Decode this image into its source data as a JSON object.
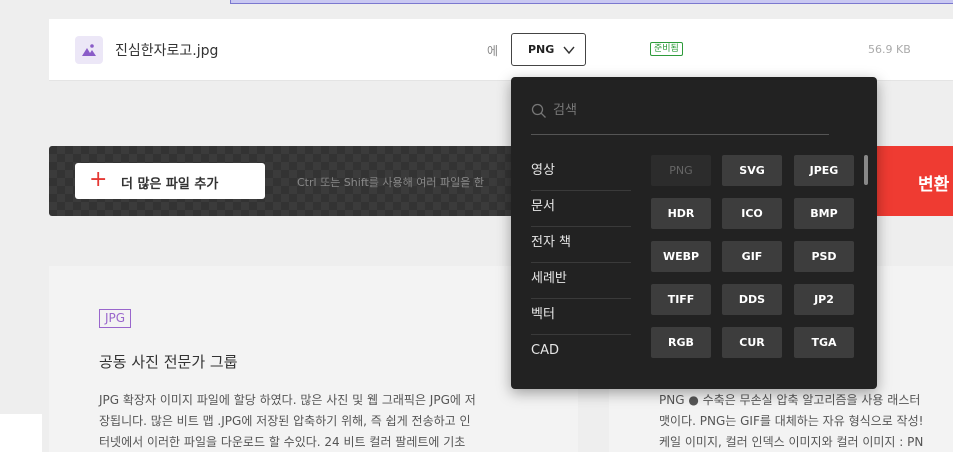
{
  "file": {
    "name": "진심한자로고.jpg",
    "to_label": "에",
    "target_format": "PNG",
    "status": "준비됨",
    "size": "56.9 KB"
  },
  "actions": {
    "add_label": "더 많은 파일 추가",
    "hint": "Ctrl 또는 Shift를 사용해 여러 파일을 한",
    "convert_label": "변환"
  },
  "dropdown": {
    "search_placeholder": "검색",
    "categories": [
      "영상",
      "문서",
      "전자 책",
      "세례반",
      "벡터",
      "CAD"
    ],
    "formats": [
      "PNG",
      "SVG",
      "JPEG",
      "HDR",
      "ICO",
      "BMP",
      "WEBP",
      "GIF",
      "PSD",
      "TIFF",
      "DDS",
      "JP2",
      "RGB",
      "CUR",
      "TGA"
    ],
    "selected_format": "PNG"
  },
  "cards": {
    "left": {
      "tag": "JPG",
      "title": "공동 사진 전문가 그룹",
      "lines": [
        "JPG 확장자 이미지 파일에 할당 하였다. 많은 사진 및 웹 그래픽은 JPG에 저",
        "장됩니다. 많은 비트 맵 .JPG에 저장된 압축하기 위해, 즉 쉽게 전송하고 인",
        "터넷에서 이러한 파일을 다운로드 할 수있다. 24 비트 컬러 팔레트에 기초"
      ]
    },
    "right": {
      "lines": [
        "PNG ● 수축은 무손실 압축 알고리즘을 사용 래스터",
        "맷이다. PNG는 GIF를 대체하는 자유 형식으로 작성!",
        "케일 이미지, 컬러 인덱스 이미지와 컬러 이미지 : PN"
      ]
    }
  }
}
